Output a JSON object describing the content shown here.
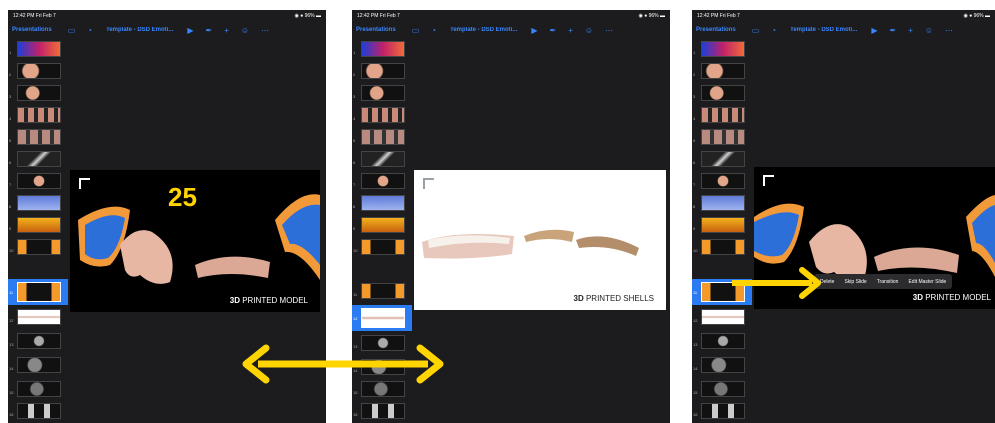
{
  "status": {
    "time": "12:42 PM  Fri Feb 7",
    "battery": "◉ ● 96% ▬"
  },
  "toolbar": {
    "presentations": "Presentations",
    "title": "Template - DSD Emoti...",
    "play": "▶",
    "format": "✒",
    "add": "+",
    "collab": "☺",
    "more": "⋯"
  },
  "thumb_numbers": [
    "1",
    "2",
    "3",
    "4",
    "5",
    "6",
    "7",
    "8",
    "9",
    "10",
    "11",
    "12",
    "13",
    "14",
    "15",
    "16"
  ],
  "slides": {
    "left": {
      "number": "25",
      "caption_bold": "3D",
      "caption_rest": " PRINTED MODEL"
    },
    "middle": {
      "caption_bold": "3D",
      "caption_rest": " PRINTED SHELLS"
    },
    "right": {
      "caption_bold": "3D",
      "caption_rest": " PRINTED MODEL"
    }
  },
  "context_menu": [
    "Delete",
    "Skip Slide",
    "Transition",
    "Edit Master Slide"
  ],
  "colors": {
    "accent": "#2b7cf2",
    "annotation_yellow": "#ffd400",
    "app_bg": "#1c1c1e"
  }
}
